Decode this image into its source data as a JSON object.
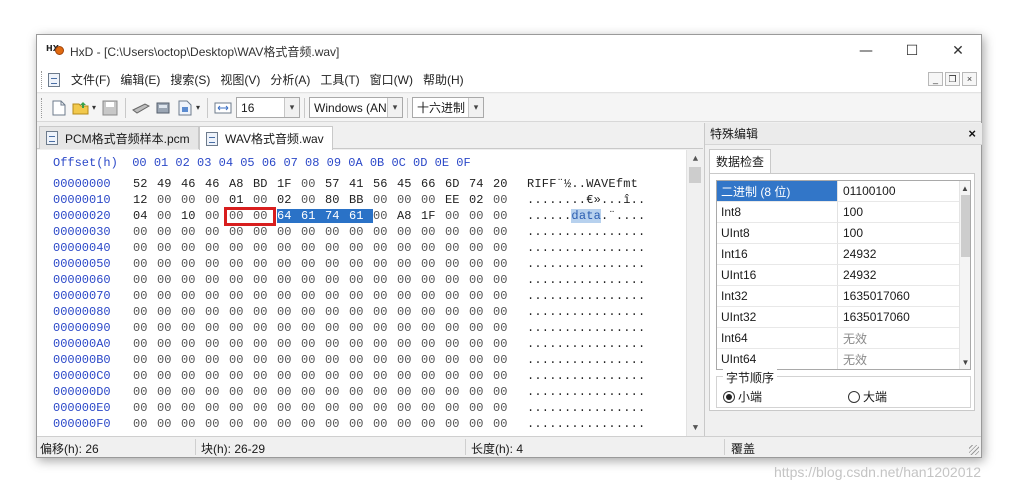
{
  "window": {
    "title": "HxD - [C:\\Users\\octop\\Desktop\\WAV格式音频.wav]",
    "app_icon_text": "HX",
    "controls": {
      "minimize": "—",
      "maximize": "☐",
      "close": "✕"
    }
  },
  "menu": {
    "items": [
      "文件(F)",
      "编辑(E)",
      "搜索(S)",
      "视图(V)",
      "分析(A)",
      "工具(T)",
      "窗口(W)",
      "帮助(H)"
    ],
    "mdi": {
      "minimize": "_",
      "restore": "❐",
      "close": "×"
    }
  },
  "toolbar": {
    "bytes_per_row": "16",
    "charset": "Windows (ANSI)",
    "offset_base": "十六进制",
    "dropdown_glyph": "▾"
  },
  "tabs": [
    {
      "label": "PCM格式音频样本.pcm",
      "active": false
    },
    {
      "label": "WAV格式音频.wav",
      "active": true
    }
  ],
  "hex": {
    "header": "Offset(h)  00 01 02 03 04 05 06 07 08 09 0A 0B 0C 0D 0E 0F",
    "rows": [
      {
        "offset": "00000000",
        "bytes": [
          "52",
          "49",
          "46",
          "46",
          "A8",
          "BD",
          "1F",
          "00",
          "57",
          "41",
          "56",
          "45",
          "66",
          "6D",
          "74",
          "20"
        ],
        "ascii": "RIFF¨½..WAVEfmt "
      },
      {
        "offset": "00000010",
        "bytes": [
          "12",
          "00",
          "00",
          "00",
          "01",
          "00",
          "02",
          "00",
          "80",
          "BB",
          "00",
          "00",
          "00",
          "EE",
          "02",
          "00"
        ],
        "ascii": "........€»...î.."
      },
      {
        "offset": "00000020",
        "bytes": [
          "04",
          "00",
          "10",
          "00",
          "00",
          "00",
          "64",
          "61",
          "74",
          "61",
          "00",
          "A8",
          "1F",
          "00",
          "00",
          "00"
        ],
        "ascii_pre": "......",
        "ascii_sel": "data",
        "ascii_post": ".¨...."
      },
      {
        "offset": "00000030",
        "bytes": [
          "00",
          "00",
          "00",
          "00",
          "00",
          "00",
          "00",
          "00",
          "00",
          "00",
          "00",
          "00",
          "00",
          "00",
          "00",
          "00"
        ],
        "ascii": "................"
      },
      {
        "offset": "00000040",
        "bytes": [
          "00",
          "00",
          "00",
          "00",
          "00",
          "00",
          "00",
          "00",
          "00",
          "00",
          "00",
          "00",
          "00",
          "00",
          "00",
          "00"
        ],
        "ascii": "................"
      },
      {
        "offset": "00000050",
        "bytes": [
          "00",
          "00",
          "00",
          "00",
          "00",
          "00",
          "00",
          "00",
          "00",
          "00",
          "00",
          "00",
          "00",
          "00",
          "00",
          "00"
        ],
        "ascii": "................"
      },
      {
        "offset": "00000060",
        "bytes": [
          "00",
          "00",
          "00",
          "00",
          "00",
          "00",
          "00",
          "00",
          "00",
          "00",
          "00",
          "00",
          "00",
          "00",
          "00",
          "00"
        ],
        "ascii": "................"
      },
      {
        "offset": "00000070",
        "bytes": [
          "00",
          "00",
          "00",
          "00",
          "00",
          "00",
          "00",
          "00",
          "00",
          "00",
          "00",
          "00",
          "00",
          "00",
          "00",
          "00"
        ],
        "ascii": "................"
      },
      {
        "offset": "00000080",
        "bytes": [
          "00",
          "00",
          "00",
          "00",
          "00",
          "00",
          "00",
          "00",
          "00",
          "00",
          "00",
          "00",
          "00",
          "00",
          "00",
          "00"
        ],
        "ascii": "................"
      },
      {
        "offset": "00000090",
        "bytes": [
          "00",
          "00",
          "00",
          "00",
          "00",
          "00",
          "00",
          "00",
          "00",
          "00",
          "00",
          "00",
          "00",
          "00",
          "00",
          "00"
        ],
        "ascii": "................"
      },
      {
        "offset": "000000A0",
        "bytes": [
          "00",
          "00",
          "00",
          "00",
          "00",
          "00",
          "00",
          "00",
          "00",
          "00",
          "00",
          "00",
          "00",
          "00",
          "00",
          "00"
        ],
        "ascii": "................"
      },
      {
        "offset": "000000B0",
        "bytes": [
          "00",
          "00",
          "00",
          "00",
          "00",
          "00",
          "00",
          "00",
          "00",
          "00",
          "00",
          "00",
          "00",
          "00",
          "00",
          "00"
        ],
        "ascii": "................"
      },
      {
        "offset": "000000C0",
        "bytes": [
          "00",
          "00",
          "00",
          "00",
          "00",
          "00",
          "00",
          "00",
          "00",
          "00",
          "00",
          "00",
          "00",
          "00",
          "00",
          "00"
        ],
        "ascii": "................"
      },
      {
        "offset": "000000D0",
        "bytes": [
          "00",
          "00",
          "00",
          "00",
          "00",
          "00",
          "00",
          "00",
          "00",
          "00",
          "00",
          "00",
          "00",
          "00",
          "00",
          "00"
        ],
        "ascii": "................"
      },
      {
        "offset": "000000E0",
        "bytes": [
          "00",
          "00",
          "00",
          "00",
          "00",
          "00",
          "00",
          "00",
          "00",
          "00",
          "00",
          "00",
          "00",
          "00",
          "00",
          "00"
        ],
        "ascii": "................"
      },
      {
        "offset": "000000F0",
        "bytes": [
          "00",
          "00",
          "00",
          "00",
          "00",
          "00",
          "00",
          "00",
          "00",
          "00",
          "00",
          "00",
          "00",
          "00",
          "00",
          "00"
        ],
        "ascii": "................"
      }
    ],
    "scroll_up": "▲",
    "scroll_down": "▼"
  },
  "status": {
    "offset": "偏移(h): 26",
    "block": "块(h): 26-29",
    "length": "长度(h): 4",
    "mode": "覆盖"
  },
  "side_panel": {
    "title": "特殊编辑",
    "close": "×",
    "tab": "数据检查",
    "inspector": [
      {
        "key": "二进制 (8 位)",
        "value": "01100100"
      },
      {
        "key": "Int8",
        "value": "100"
      },
      {
        "key": "UInt8",
        "value": "100"
      },
      {
        "key": "Int16",
        "value": "24932"
      },
      {
        "key": "UInt16",
        "value": "24932"
      },
      {
        "key": "Int32",
        "value": "1635017060"
      },
      {
        "key": "UInt32",
        "value": "1635017060"
      },
      {
        "key": "Int64",
        "value": "无效"
      },
      {
        "key": "UInt64",
        "value": "无效"
      }
    ],
    "byte_order": {
      "label": "字节顺序",
      "little": "小端",
      "big": "大端"
    }
  },
  "watermark": "https://blog.csdn.net/han1202012",
  "colors": {
    "offset_blue": "#2b48c8",
    "selection": "#2a72c7",
    "highlight_box": "#d81e1e"
  }
}
